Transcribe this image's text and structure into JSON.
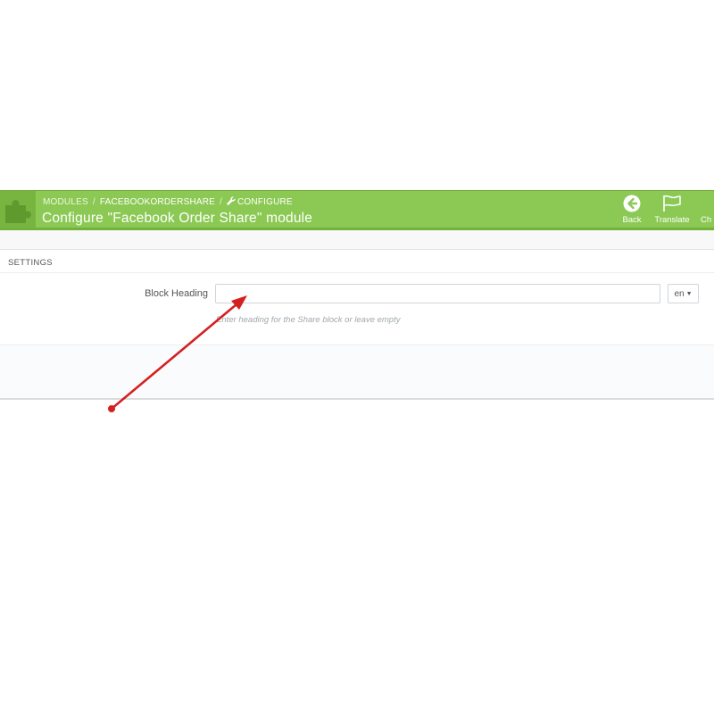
{
  "breadcrumb": {
    "items": [
      "MODULES",
      "FACEBOOKORDERSHARE",
      "CONFIGURE"
    ],
    "separator": "/"
  },
  "page_title": "Configure \"Facebook Order Share\" module",
  "toolbar": {
    "back_label": "Back",
    "translate_label": "Translate",
    "check_label": "Ch"
  },
  "panel": {
    "heading": "SETTINGS",
    "field_label": "Block Heading",
    "field_value": "",
    "language": "en",
    "help_text": "Enter heading for the Share block or leave empty"
  },
  "colors": {
    "toolbar_bg": "#8bc954",
    "annotation_arrow": "#d42020"
  },
  "icons": {
    "module": "puzzle-icon",
    "back": "arrow-left-circle-icon",
    "translate": "flag-icon",
    "configure": "wrench-icon"
  }
}
